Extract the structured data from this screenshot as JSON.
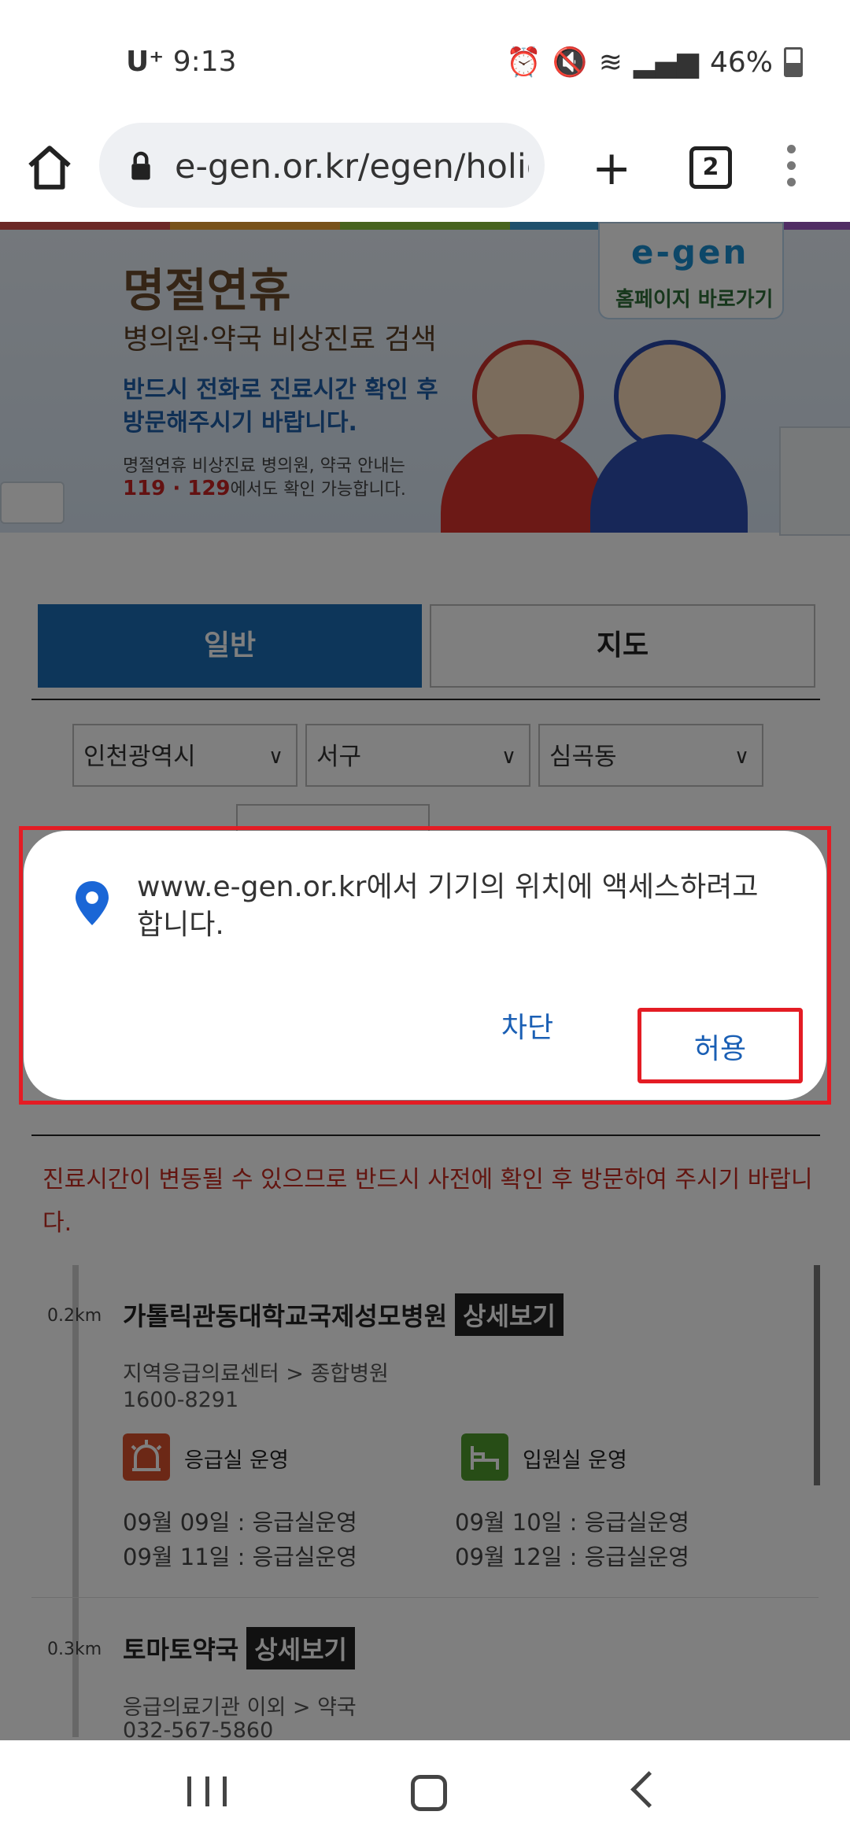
{
  "status_bar": {
    "carrier": "U⁺",
    "time": "9:13",
    "battery": "46%"
  },
  "browser": {
    "url": "e-gen.or.kr/egen/holid",
    "tab_count": "2"
  },
  "banner": {
    "title": "명절연휴",
    "subtitle": "병의원·약국 비상진료 검색",
    "line1": "반드시 전화로 진료시간 확인 후",
    "line2": "방문해주시기 바랍니다.",
    "note1": "명절연휴 비상진료 병의원, 약국 안내는",
    "note2_numbers": "119 · 129",
    "note2_rest": "에서도 확인 가능합니다.",
    "logo": "e-gen",
    "home_link": "홈페이지 바로가기"
  },
  "tabs": {
    "general": "일반",
    "map": "지도"
  },
  "filters": {
    "city": "인천광역시",
    "district": "서구",
    "dong": "심곡동"
  },
  "notice": "진료시간이 변동될 수 있으므로 반드시 사전에 확인 후 방문하여 주시기 바랍니다.",
  "results": [
    {
      "distance": "0.2km",
      "name": "가톨릭관동대학교국제성모병원",
      "detail_label": "상세보기",
      "category": "지역응급의료센터 > 종합병원",
      "phone": "1600-8291",
      "services": [
        "응급실 운영",
        "입원실 운영"
      ],
      "schedule": [
        "09월 09일 : 응급실운영",
        "09월 10일 : 응급실운영",
        "09월 11일 : 응급실운영",
        "09월 12일 : 응급실운영"
      ]
    },
    {
      "distance": "0.3km",
      "name": "토마토약국",
      "detail_label": "상세보기",
      "category": "응급의료기관 이외 > 약국",
      "phone": "032-567-5860"
    }
  ],
  "dialog": {
    "message": "www.e-gen.or.kr에서 기기의 위치에 액세스하려고 합니다.",
    "block": "차단",
    "allow": "허용"
  },
  "colors": {
    "accent": "#1a6cb4",
    "highlight": "#e41c24",
    "notice": "#c52a20"
  }
}
